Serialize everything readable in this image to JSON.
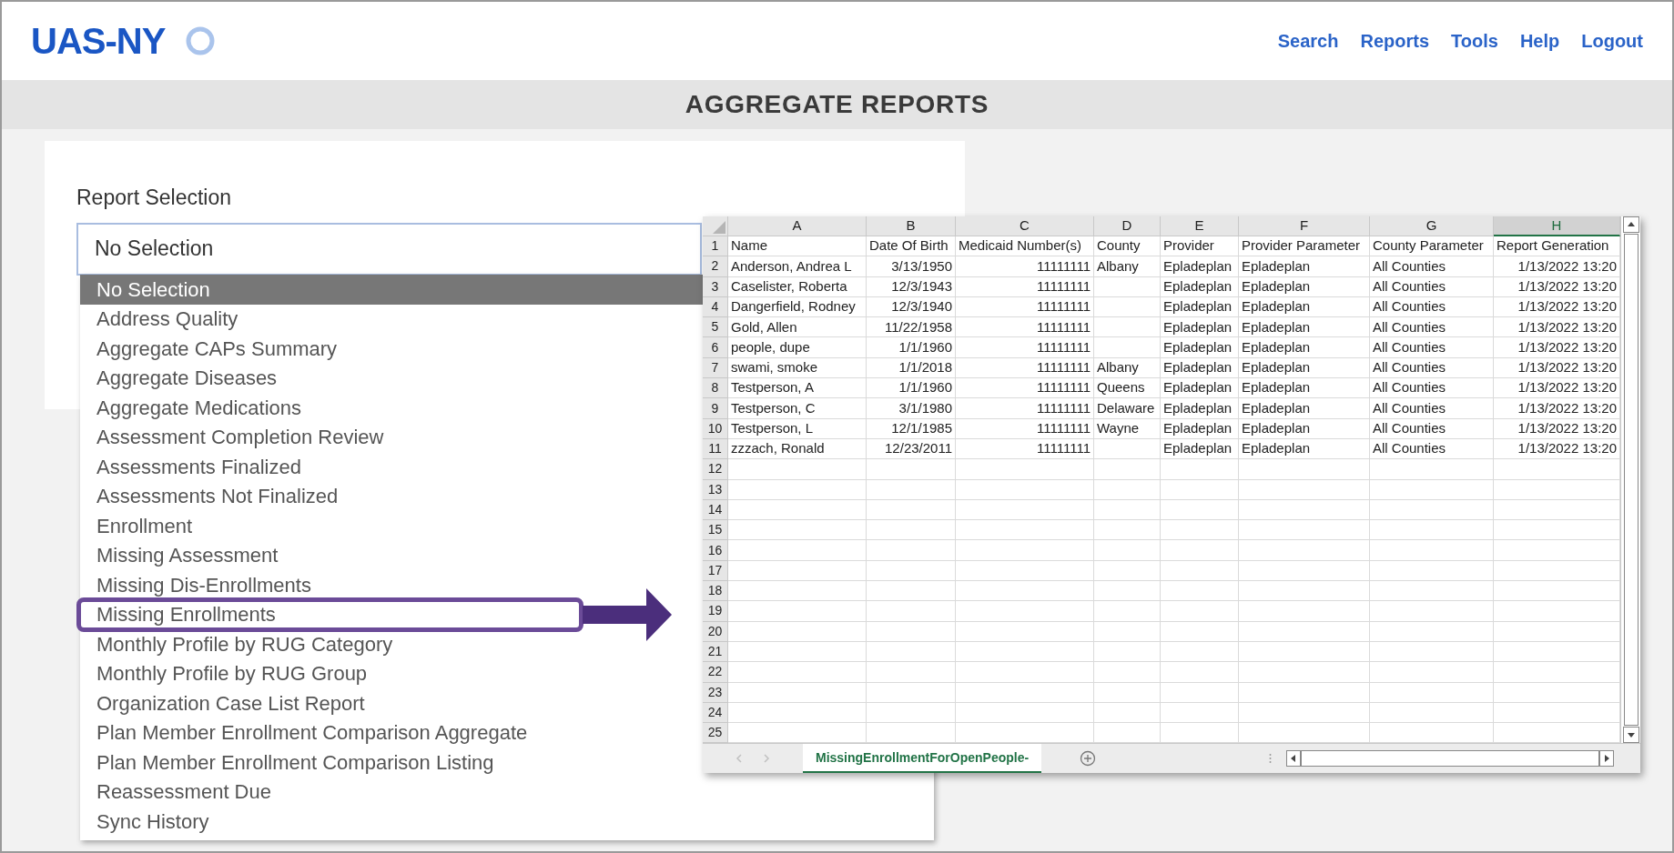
{
  "header": {
    "logo": "UAS-NY",
    "nav": [
      {
        "label": "Search"
      },
      {
        "label": "Reports"
      },
      {
        "label": "Tools"
      },
      {
        "label": "Help"
      },
      {
        "label": "Logout"
      }
    ]
  },
  "page_title": "AGGREGATE REPORTS",
  "report_selection": {
    "label": "Report Selection",
    "value": "No Selection",
    "options": [
      {
        "label": "No Selection",
        "selected": true,
        "highlighted": false
      },
      {
        "label": "Address Quality",
        "selected": false,
        "highlighted": false
      },
      {
        "label": "Aggregate CAPs Summary",
        "selected": false,
        "highlighted": false
      },
      {
        "label": "Aggregate Diseases",
        "selected": false,
        "highlighted": false
      },
      {
        "label": "Aggregate Medications",
        "selected": false,
        "highlighted": false
      },
      {
        "label": "Assessment Completion Review",
        "selected": false,
        "highlighted": false
      },
      {
        "label": "Assessments Finalized",
        "selected": false,
        "highlighted": false
      },
      {
        "label": "Assessments Not Finalized",
        "selected": false,
        "highlighted": false
      },
      {
        "label": "Enrollment",
        "selected": false,
        "highlighted": false
      },
      {
        "label": "Missing Assessment",
        "selected": false,
        "highlighted": false
      },
      {
        "label": "Missing Dis-Enrollments",
        "selected": false,
        "highlighted": false
      },
      {
        "label": "Missing Enrollments",
        "selected": false,
        "highlighted": true
      },
      {
        "label": "Monthly Profile by RUG Category",
        "selected": false,
        "highlighted": false
      },
      {
        "label": "Monthly Profile by RUG Group",
        "selected": false,
        "highlighted": false
      },
      {
        "label": "Organization Case List Report",
        "selected": false,
        "highlighted": false
      },
      {
        "label": "Plan Member Enrollment Comparison Aggregate",
        "selected": false,
        "highlighted": false
      },
      {
        "label": "Plan Member Enrollment Comparison Listing",
        "selected": false,
        "highlighted": false
      },
      {
        "label": "Reassessment Due",
        "selected": false,
        "highlighted": false
      },
      {
        "label": "Sync History",
        "selected": false,
        "highlighted": false
      }
    ]
  },
  "spreadsheet": {
    "columns": [
      {
        "label": "A",
        "selected": false
      },
      {
        "label": "B",
        "selected": false
      },
      {
        "label": "C",
        "selected": false
      },
      {
        "label": "D",
        "selected": false
      },
      {
        "label": "E",
        "selected": false
      },
      {
        "label": "F",
        "selected": false
      },
      {
        "label": "G",
        "selected": false
      },
      {
        "label": "H",
        "selected": true
      }
    ],
    "row_numbers": [
      "1",
      "2",
      "3",
      "4",
      "5",
      "6",
      "7",
      "8",
      "9",
      "10",
      "11",
      "12",
      "13",
      "14",
      "15",
      "16",
      "17",
      "18",
      "19",
      "20",
      "21",
      "22",
      "23",
      "24",
      "25"
    ],
    "rows": [
      {
        "A": "Name",
        "B": "Date Of Birth",
        "C": "Medicaid Number(s)",
        "D": "County",
        "E": "Provider",
        "F": "Provider Parameter",
        "G": "County Parameter",
        "H": "Report Generation"
      },
      {
        "A": "Anderson, Andrea L",
        "B": "3/13/1950",
        "C": "11111111",
        "D": "Albany",
        "E": "Epladeplan",
        "F": "Epladeplan",
        "G": "All Counties",
        "H": "1/13/2022 13:20"
      },
      {
        "A": "Caselister, Roberta",
        "B": "12/3/1943",
        "C": "11111111",
        "E": "Epladeplan",
        "F": "Epladeplan",
        "G": "All Counties",
        "H": "1/13/2022 13:20"
      },
      {
        "A": "Dangerfield, Rodney",
        "B": "12/3/1940",
        "C": "11111111",
        "E": "Epladeplan",
        "F": "Epladeplan",
        "G": "All Counties",
        "H": "1/13/2022 13:20"
      },
      {
        "A": "Gold, Allen",
        "B": "11/22/1958",
        "C": "11111111",
        "E": "Epladeplan",
        "F": "Epladeplan",
        "G": "All Counties",
        "H": "1/13/2022 13:20"
      },
      {
        "A": "people, dupe",
        "B": "1/1/1960",
        "C": "11111111",
        "E": "Epladeplan",
        "F": "Epladeplan",
        "G": "All Counties",
        "H": "1/13/2022 13:20"
      },
      {
        "A": "swami, smoke",
        "B": "1/1/2018",
        "C": "11111111",
        "D": "Albany",
        "E": "Epladeplan",
        "F": "Epladeplan",
        "G": "All Counties",
        "H": "1/13/2022 13:20"
      },
      {
        "A": "Testperson, A",
        "B": "1/1/1960",
        "C": "11111111",
        "D": "Queens",
        "E": "Epladeplan",
        "F": "Epladeplan",
        "G": "All Counties",
        "H": "1/13/2022 13:20"
      },
      {
        "A": "Testperson, C",
        "B": "3/1/1980",
        "C": "11111111",
        "D": "Delaware",
        "E": "Epladeplan",
        "F": "Epladeplan",
        "G": "All Counties",
        "H": "1/13/2022 13:20"
      },
      {
        "A": "Testperson, L",
        "B": "12/1/1985",
        "C": "11111111",
        "D": "Wayne",
        "E": "Epladeplan",
        "F": "Epladeplan",
        "G": "All Counties",
        "H": "1/13/2022 13:20"
      },
      {
        "A": "zzzach, Ronald",
        "B": "12/23/2011",
        "C": "11111111",
        "E": "Epladeplan",
        "F": "Epladeplan",
        "G": "All Counties",
        "H": "1/13/2022 13:20"
      }
    ],
    "sheet_tabs": [
      {
        "label": "MissingEnrollmentForOpenPeople-",
        "selected": true
      }
    ]
  }
}
